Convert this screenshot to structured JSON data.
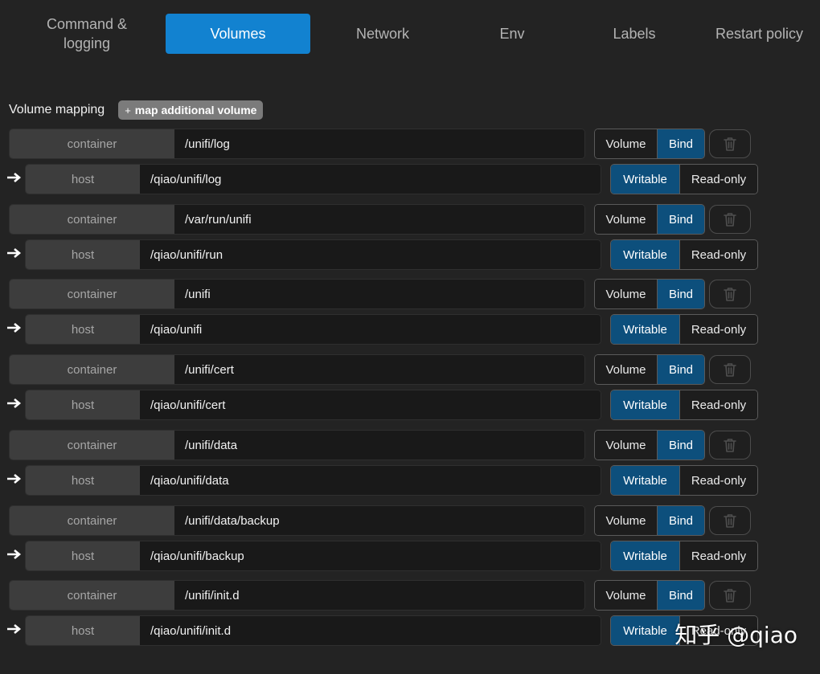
{
  "tabs": [
    {
      "label": "Command &\nlogging",
      "active": false
    },
    {
      "label": "Volumes",
      "active": true
    },
    {
      "label": "Network",
      "active": false
    },
    {
      "label": "Env",
      "active": false
    },
    {
      "label": "Labels",
      "active": false
    },
    {
      "label": "Restart policy",
      "active": false
    }
  ],
  "volume_mapping": {
    "title": "Volume mapping",
    "add_button_icon": "+",
    "add_button_label": "map additional volume",
    "container_label": "container",
    "host_label": "host",
    "arrow_icon": "arrow-right-icon",
    "type_options": [
      "Volume",
      "Bind"
    ],
    "mode_options": [
      "Writable",
      "Read-only"
    ],
    "mappings": [
      {
        "container": "/unifi/log",
        "host": "/qiao/unifi/log",
        "type": "Bind",
        "mode": "Writable"
      },
      {
        "container": "/var/run/unifi",
        "host": "/qiao/unifi/run",
        "type": "Bind",
        "mode": "Writable"
      },
      {
        "container": "/unifi",
        "host": "/qiao/unifi",
        "type": "Bind",
        "mode": "Writable"
      },
      {
        "container": "/unifi/cert",
        "host": "/qiao/unifi/cert",
        "type": "Bind",
        "mode": "Writable"
      },
      {
        "container": "/unifi/data",
        "host": "/qiao/unifi/data",
        "type": "Bind",
        "mode": "Writable"
      },
      {
        "container": "/unifi/data/backup",
        "host": "/qiao/unifi/backup",
        "type": "Bind",
        "mode": "Writable"
      },
      {
        "container": "/unifi/init.d",
        "host": "/qiao/unifi/init.d",
        "type": "Bind",
        "mode": "Writable"
      }
    ]
  },
  "watermark": "知乎 @qiao",
  "colors": {
    "accent": "#1282d0",
    "segment_active": "#0d4f7c",
    "background": "#232323"
  }
}
